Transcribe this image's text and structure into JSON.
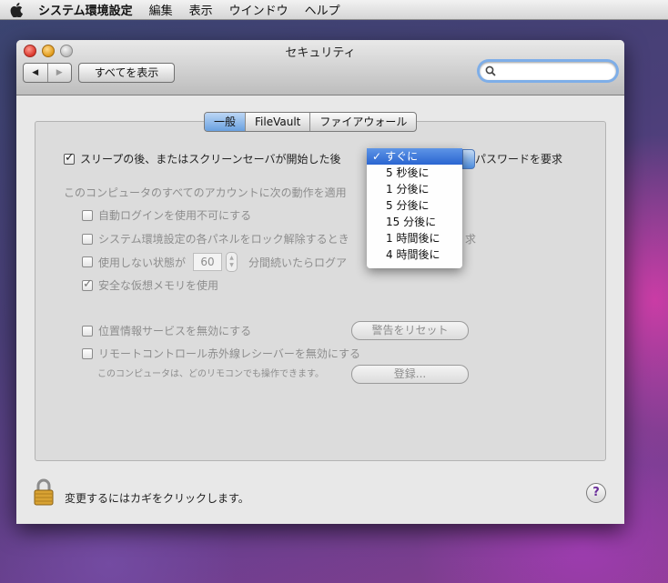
{
  "menubar": {
    "app": "システム環境設定",
    "items": [
      "編集",
      "表示",
      "ウインドウ",
      "ヘルプ"
    ]
  },
  "window": {
    "title": "セキュリティ",
    "show_all": "すべてを表示",
    "search_placeholder": ""
  },
  "tabs": [
    "一般",
    "FileVault",
    "ファイアウォール"
  ],
  "general": {
    "password_require_prefix": "スリープの後、またはスクリーンセーバが開始した後",
    "password_require_suffix": "パスワードを要求",
    "section_label": "このコンピュータのすべてのアカウントに次の動作を適用",
    "auto_login": "自動ログインを使用不可にする",
    "unlock_panels": "システム環境設定の各パネルをロック解除するとき",
    "unlock_panels_tail": "求",
    "logout_prefix": "使用しない状態が",
    "logout_minutes": "60",
    "logout_suffix": "分間続いたらログア",
    "secure_vm": "安全な仮想メモリを使用",
    "location_disable": "位置情報サービスを無効にする",
    "reset_warnings": "警告をリセット",
    "remote_disable": "リモートコントロール赤外線レシーバーを無効にする",
    "remote_note": "このコンピュータは、どのリモコンでも操作できます。",
    "register": "登録..."
  },
  "popup": {
    "selected": "すぐに",
    "options": [
      "すぐに",
      "5 秒後に",
      "1 分後に",
      "5 分後に",
      "15 分後に",
      "1 時間後に",
      "4 時間後に"
    ]
  },
  "footer": {
    "lock_text": "変更するにはカギをクリックします。",
    "help": "?"
  },
  "colors": {
    "accent": "#2a65d1",
    "tab_active": "#6aa1e0",
    "lock_gold": "#d8a233"
  }
}
